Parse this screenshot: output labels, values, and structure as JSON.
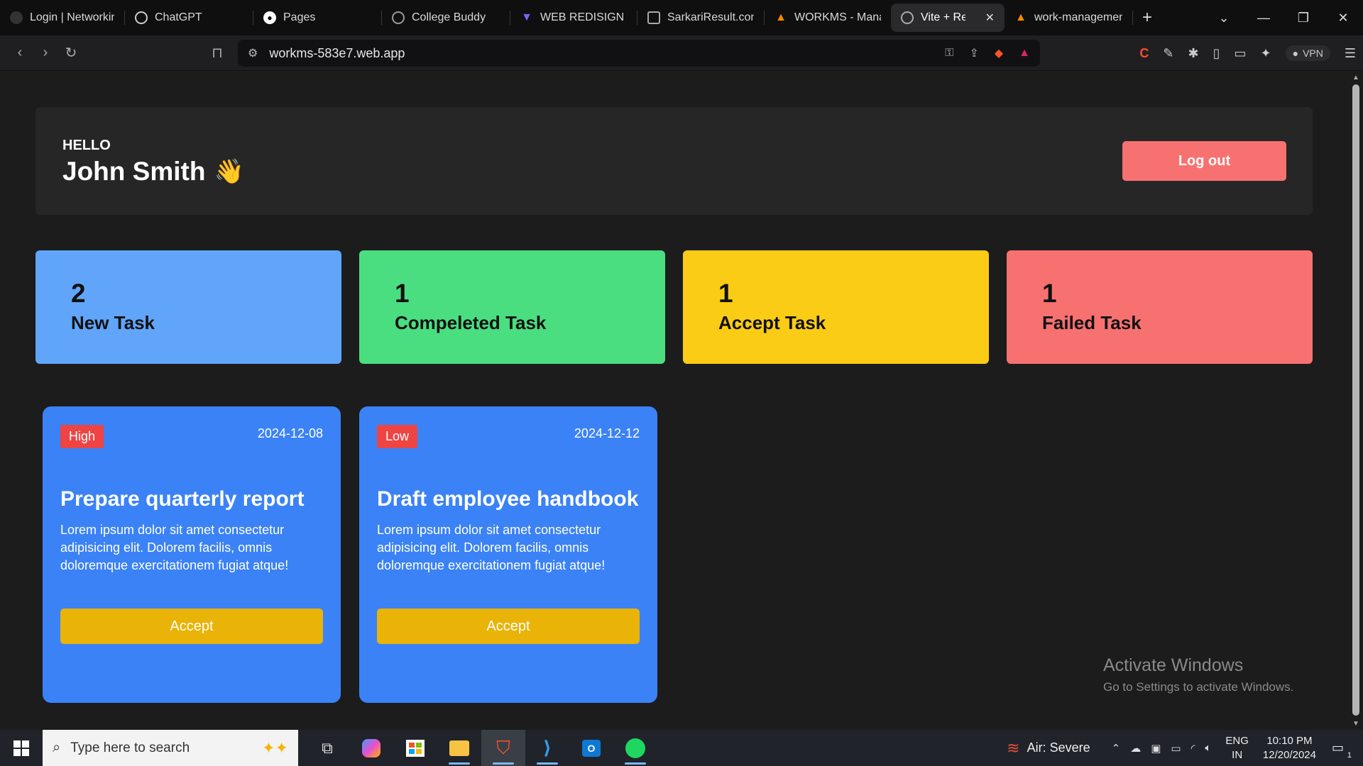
{
  "browser": {
    "tabs": [
      {
        "label": "Login | Networkin",
        "icon": "page-icon",
        "color": "#9aa0a6"
      },
      {
        "label": "ChatGPT",
        "icon": "chatgpt-icon",
        "color": "#d8d8d8"
      },
      {
        "label": "Pages",
        "icon": "github-icon",
        "color": "#ffffff"
      },
      {
        "label": "College Buddy",
        "icon": "globe-icon",
        "color": "#9aa0a6"
      },
      {
        "label": "WEB REDISIGN",
        "icon": "figma-icon",
        "color": "#7b61ff"
      },
      {
        "label": "SarkariResult.com",
        "icon": "page-icon",
        "color": "#b0b0b0"
      },
      {
        "label": "WORKMS - Mana",
        "icon": "firebase-icon",
        "color": "#ff8a00"
      },
      {
        "label": "Vite + React",
        "icon": "globe-icon",
        "color": "#9aa0a6",
        "active": true
      },
      {
        "label": "work-managemen",
        "icon": "firebase-icon",
        "color": "#ff8a00"
      }
    ],
    "url": "workms-583e7.web.app",
    "vpn_label": "VPN"
  },
  "header": {
    "greeting": "HELLO",
    "name": "John Smith",
    "emoji": "👋",
    "logout_label": "Log out"
  },
  "stats": [
    {
      "count": "2",
      "label": "New Task",
      "color": "#60a5fa"
    },
    {
      "count": "1",
      "label": "Compeleted Task",
      "color": "#4ade80"
    },
    {
      "count": "1",
      "label": "Accept Task",
      "color": "#facc15"
    },
    {
      "count": "1",
      "label": "Failed Task",
      "color": "#f87171"
    }
  ],
  "tasks": [
    {
      "priority": "High",
      "date": "2024-12-08",
      "title": "Prepare quarterly report",
      "description": "Lorem ipsum dolor sit amet consectetur adipisicing elit. Dolorem facilis, omnis doloremque exercitationem fugiat atque!",
      "action_label": "Accept"
    },
    {
      "priority": "Low",
      "date": "2024-12-12",
      "title": "Draft employee handbook",
      "description": "Lorem ipsum dolor sit amet consectetur adipisicing elit. Dolorem facilis, omnis doloremque exercitationem fugiat atque!",
      "action_label": "Accept"
    }
  ],
  "watermark": {
    "title": "Activate Windows",
    "subtitle": "Go to Settings to activate Windows."
  },
  "taskbar": {
    "search_placeholder": "Type here to search",
    "weather": "Air: Severe",
    "lang_top": "ENG",
    "lang_bottom": "IN",
    "time": "10:10 PM",
    "date": "12/20/2024",
    "notification_count": "1"
  }
}
